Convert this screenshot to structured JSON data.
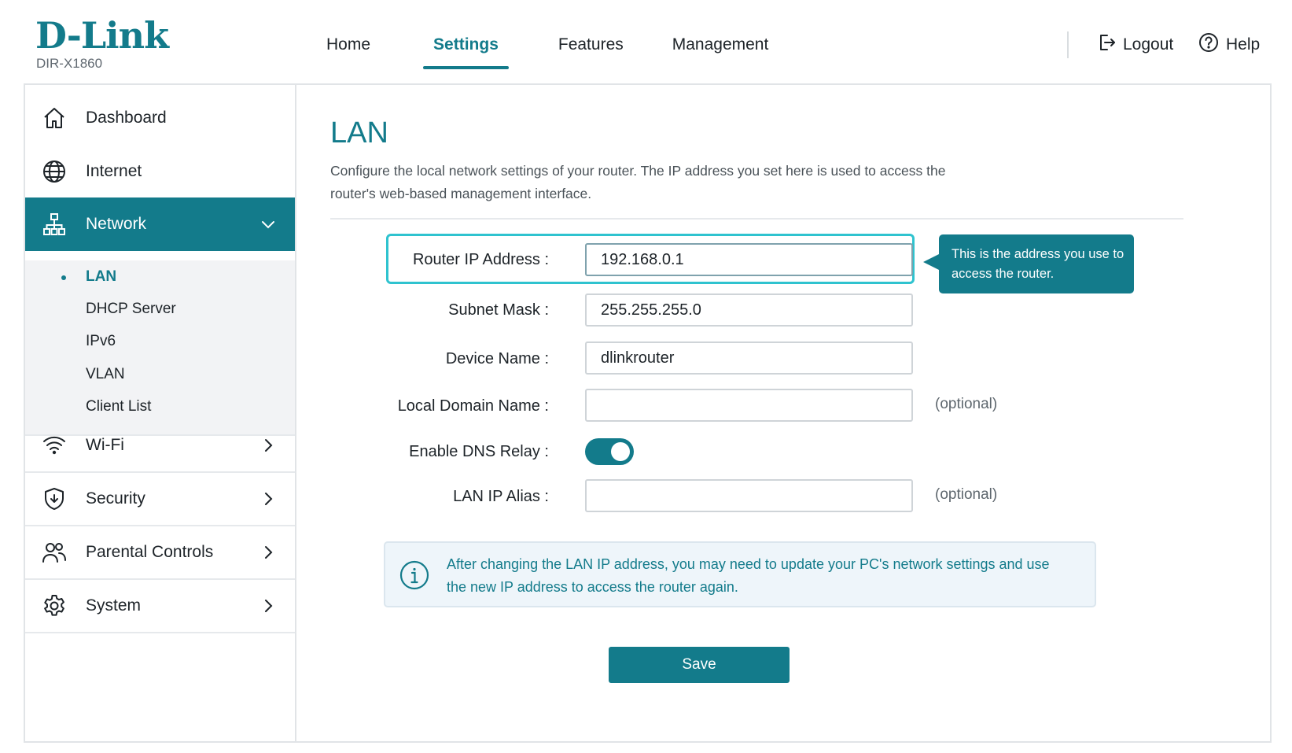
{
  "brand": {
    "logo_text": "D-Link",
    "model": "DIR-X1860",
    "accent_color": "#137b8b",
    "highlight_color": "#2fc3cf"
  },
  "top_nav": {
    "items": [
      "Home",
      "Settings",
      "Features",
      "Management"
    ],
    "active": "Settings",
    "logout_label": "Logout",
    "help_label": "Help"
  },
  "sidebar": {
    "items": [
      {
        "label": "Dashboard",
        "icon": "home-icon"
      },
      {
        "label": "Internet",
        "icon": "globe-icon"
      },
      {
        "label": "Network",
        "icon": "network-icon",
        "active": true,
        "expanded": true
      },
      {
        "label": "Wi-Fi",
        "icon": "wifi-icon"
      },
      {
        "label": "Security",
        "icon": "shield-icon"
      },
      {
        "label": "Parental Controls",
        "icon": "users-icon"
      },
      {
        "label": "System",
        "icon": "gear-icon"
      }
    ],
    "network_submenu": [
      "LAN",
      "DHCP Server",
      "IPv6",
      "VLAN",
      "Client List"
    ],
    "active_submenu": "LAN"
  },
  "page": {
    "title": "LAN",
    "description": "Configure the local network settings of your router. The IP address you set here is used to access the router's web-based management interface."
  },
  "form": {
    "router_ip": {
      "label": "Router IP Address :",
      "value": "192.168.0.1"
    },
    "subnet_mask": {
      "label": "Subnet Mask :",
      "value": "255.255.255.0"
    },
    "device_name": {
      "label": "Device Name :",
      "value": "dlinkrouter"
    },
    "local_domain": {
      "label": "Local Domain Name :",
      "value": "",
      "hint": "(optional)"
    },
    "dns_relay": {
      "label": "Enable DNS Relay :",
      "enabled": true
    },
    "lan_ip_alias": {
      "label": "LAN IP Alias :",
      "value": "",
      "hint": "(optional)"
    }
  },
  "tooltip": {
    "text": "This is the address you use to access the router."
  },
  "info_note": {
    "text": "After changing the LAN IP address, you may need to update your PC's network settings and use the new IP address to access the router again."
  },
  "actions": {
    "save_label": "Save"
  }
}
